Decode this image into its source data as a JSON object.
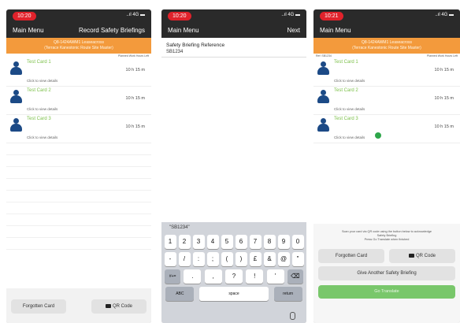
{
  "screens": [
    {
      "status": {
        "time": "10:20",
        "icons": "..ıl 4G ▬"
      },
      "nav": {
        "left": "Main Menu",
        "right": "Record Safety Briefings"
      },
      "banner": {
        "line1": "Q8-1424AWM1 Leaseacross",
        "line2": "(Terrace Kanestonic Route Site Master)"
      },
      "columns": {
        "left": "",
        "right": "Planned Work Hours Left"
      },
      "cards": [
        {
          "name": "Test Card 1",
          "time": "10 h 15 m",
          "hint": "Click to view details"
        },
        {
          "name": "Test Card 2",
          "time": "10 h 15 m",
          "hint": "Click to view details"
        },
        {
          "name": "Test Card 3",
          "time": "10 h 15 m",
          "hint": "Click to view details"
        }
      ],
      "buttons": {
        "forgotten": "Forgotten Card",
        "qr": "QR Code"
      }
    },
    {
      "status": {
        "time": "10:20",
        "icons": "..ıl 4G ▬"
      },
      "nav": {
        "left": "Main Menu",
        "right": "Next"
      },
      "field": {
        "label": "Safety Briefing Reference",
        "value": "SB1234"
      },
      "keyboard": {
        "suggestion": "\"SB1234\"",
        "row1": [
          "1",
          "2",
          "3",
          "4",
          "5",
          "6",
          "7",
          "8",
          "9",
          "0"
        ],
        "row2": [
          "-",
          "/",
          ":",
          ";",
          "(",
          ")",
          "£",
          "&",
          "@",
          "\""
        ],
        "row3": [
          "#+=",
          ".",
          ",",
          "?",
          "!",
          "'",
          "⌫"
        ],
        "row4": [
          "ABC",
          "space",
          "return"
        ]
      }
    },
    {
      "status": {
        "time": "10:21",
        "icons": "..ıl 4G ▬"
      },
      "nav": {
        "left": "Main Menu",
        "right": ""
      },
      "banner": {
        "line1": "Q8-1424AWM1 Leaseacross",
        "line2": "(Terrace Kanestonic Route Site Master)"
      },
      "columns": {
        "left": "Ref: SB1234",
        "right": "Planned Work Hours Left"
      },
      "cards": [
        {
          "name": "Test Card 1",
          "time": "10 h 15 m",
          "hint": "Click to view details"
        },
        {
          "name": "Test Card 2",
          "time": "10 h 15 m",
          "hint": "Click to view details"
        },
        {
          "name": "Test Card 3",
          "time": "10 h 15 m",
          "hint": "Click to view details"
        }
      ],
      "instructions": {
        "line1": "Scan your card via QR code using the button below to acknowledge",
        "line2": "Safety Briefing",
        "line3": "Press Go Translate when finished"
      },
      "buttons": {
        "forgotten": "Forgotten Card",
        "qr": "QR Code",
        "another": "Give Another Safety Briefing",
        "submit": "Go Translate"
      }
    }
  ],
  "colors": {
    "accent": "#f39a3c",
    "card_name": "#7cc04a",
    "user_icon": "#1c4a86",
    "time_pill": "#e0222b",
    "dot": "#2ea64a"
  }
}
